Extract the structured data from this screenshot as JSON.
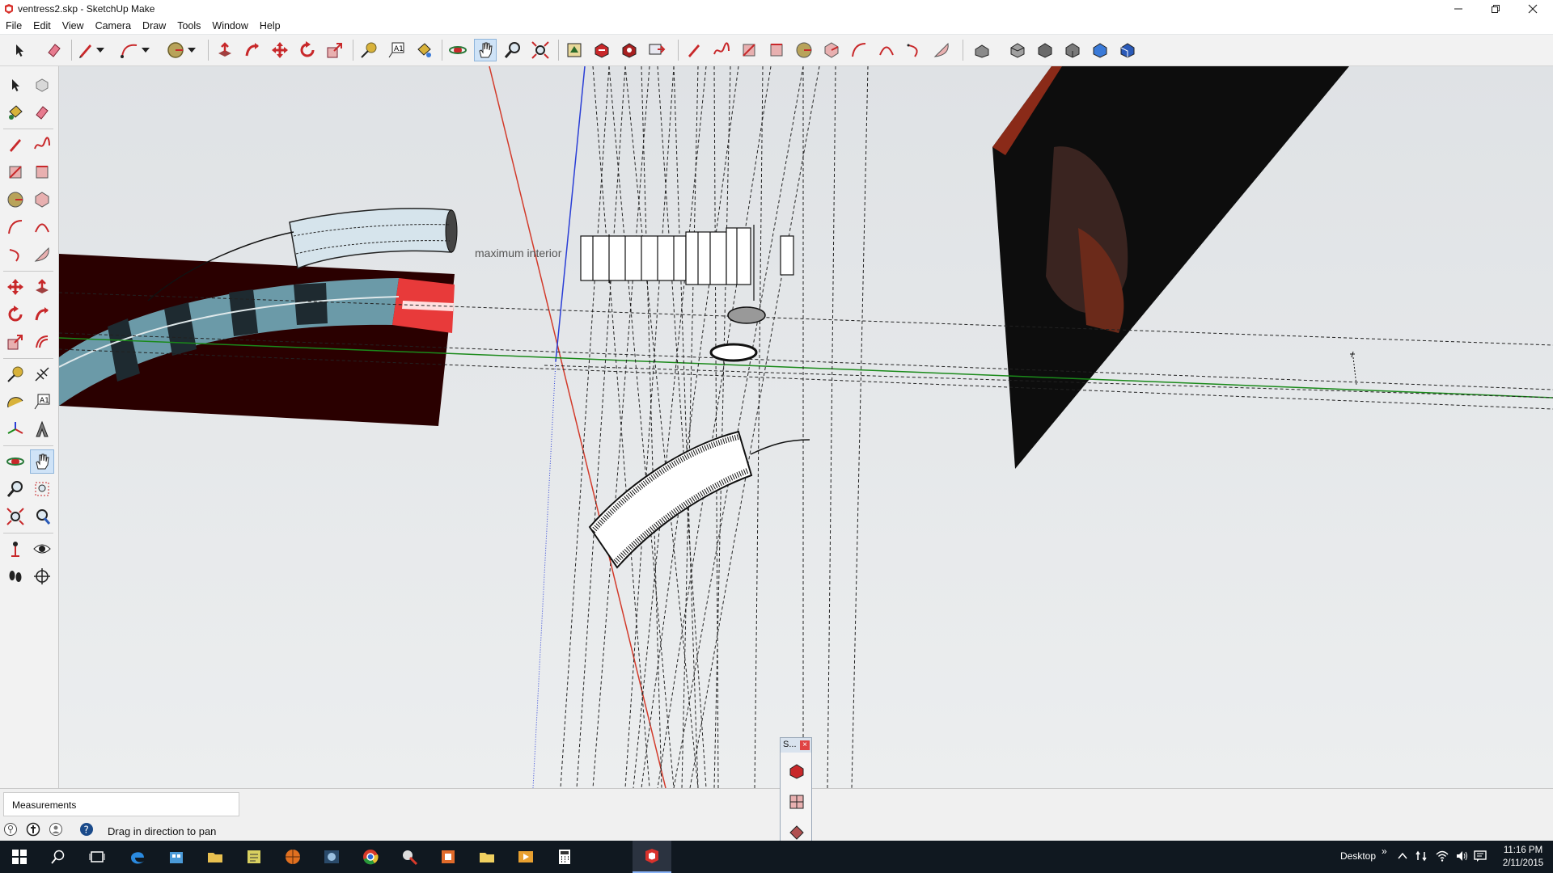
{
  "window": {
    "title": "ventress2.skp - SketchUp Make",
    "minimize_icon": "minimize-icon",
    "restore_icon": "restore-icon",
    "close_icon": "close-icon"
  },
  "menu": {
    "items": [
      "File",
      "Edit",
      "View",
      "Camera",
      "Draw",
      "Tools",
      "Window",
      "Help"
    ]
  },
  "viewport": {
    "label": "maximum interior"
  },
  "status": {
    "measurements_label": "Measurements",
    "message": "Drag in direction to pan"
  },
  "tray": {
    "title": "S...",
    "close_label": "×"
  },
  "taskbar": {
    "desktop_label": "Desktop",
    "chevron": "»",
    "time": "11:16 PM",
    "date": "2/11/2015"
  },
  "colors": {
    "axis_red": "#d23a2a",
    "axis_green": "#1a8a1a",
    "axis_blue": "#2a3ed6",
    "active_tool": "#cfe3f7",
    "taskbar": "#101820"
  }
}
